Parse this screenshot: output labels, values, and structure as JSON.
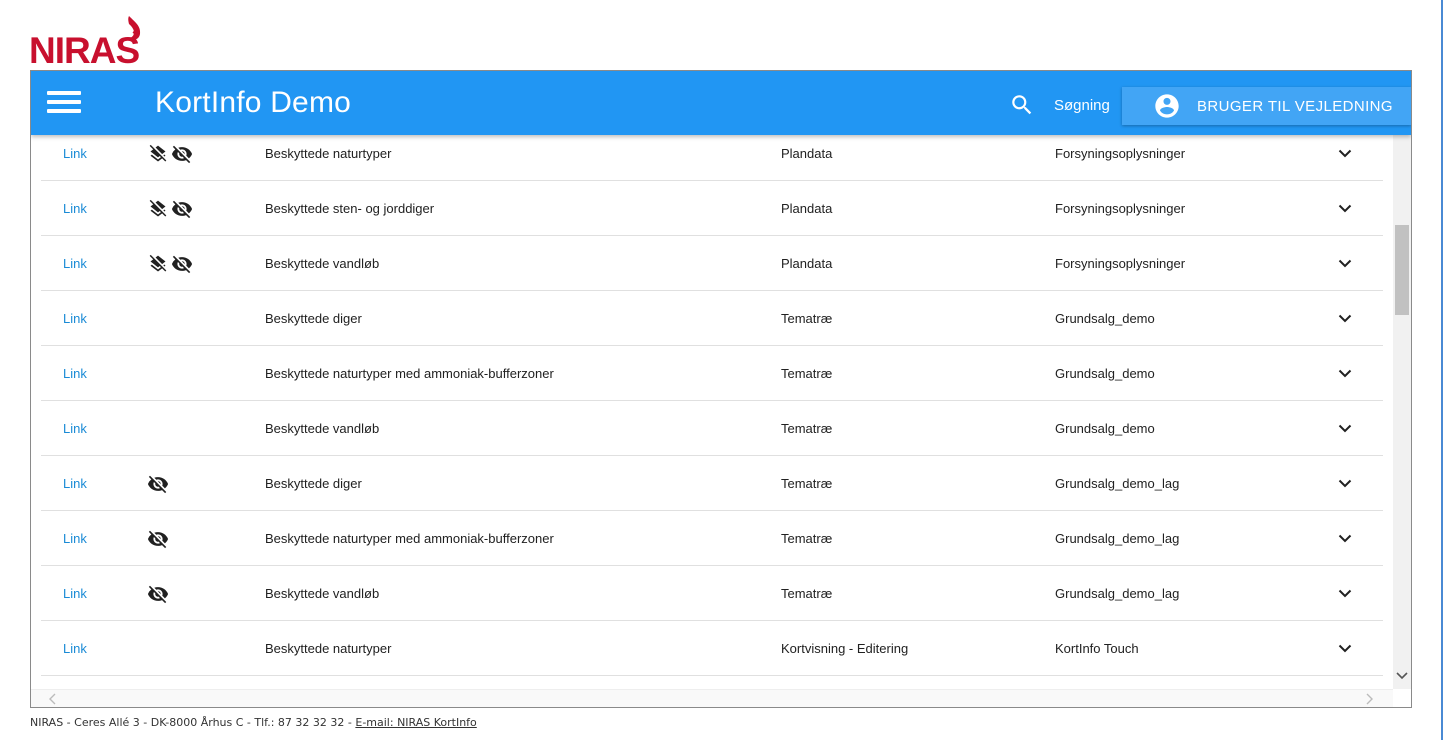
{
  "brand": {
    "logo_text": "NIRAS",
    "logo_color": "#c8102e"
  },
  "appbar": {
    "title": "KortInfo Demo",
    "search_label": "Søgning",
    "user_button_label": "BRUGER TIL VEJLEDNING",
    "background": "#2196f3"
  },
  "table": {
    "rows": [
      {
        "link": "Link",
        "icons": [
          "layers-off-icon",
          "visibility-off-icon"
        ],
        "name": "Beskyttede naturtyper",
        "source": "Plandata",
        "group": "Forsyningsoplysninger"
      },
      {
        "link": "Link",
        "icons": [
          "layers-off-icon",
          "visibility-off-icon"
        ],
        "name": "Beskyttede sten- og jorddiger",
        "source": "Plandata",
        "group": "Forsyningsoplysninger"
      },
      {
        "link": "Link",
        "icons": [
          "layers-off-icon",
          "visibility-off-icon"
        ],
        "name": "Beskyttede vandløb",
        "source": "Plandata",
        "group": "Forsyningsoplysninger"
      },
      {
        "link": "Link",
        "icons": [],
        "name": "Beskyttede diger",
        "source": "Tematræ",
        "group": "Grundsalg_demo"
      },
      {
        "link": "Link",
        "icons": [],
        "name": "Beskyttede naturtyper med ammoniak-bufferzoner",
        "source": "Tematræ",
        "group": "Grundsalg_demo"
      },
      {
        "link": "Link",
        "icons": [],
        "name": "Beskyttede vandløb",
        "source": "Tematræ",
        "group": "Grundsalg_demo"
      },
      {
        "link": "Link",
        "icons": [
          "visibility-off-icon"
        ],
        "name": "Beskyttede diger",
        "source": "Tematræ",
        "group": "Grundsalg_demo_lag"
      },
      {
        "link": "Link",
        "icons": [
          "visibility-off-icon"
        ],
        "name": "Beskyttede naturtyper med ammoniak-bufferzoner",
        "source": "Tematræ",
        "group": "Grundsalg_demo_lag"
      },
      {
        "link": "Link",
        "icons": [
          "visibility-off-icon"
        ],
        "name": "Beskyttede vandløb",
        "source": "Tematræ",
        "group": "Grundsalg_demo_lag"
      },
      {
        "link": "Link",
        "icons": [],
        "name": "Beskyttede naturtyper",
        "source": "Kortvisning - Editering",
        "group": "KortInfo Touch"
      }
    ]
  },
  "footer": {
    "address": "NIRAS - Ceres Allé 3 - DK-8000 Århus C - Tlf.: 87 32 32 32 - ",
    "email_link": "E-mail: NIRAS KortInfo"
  }
}
